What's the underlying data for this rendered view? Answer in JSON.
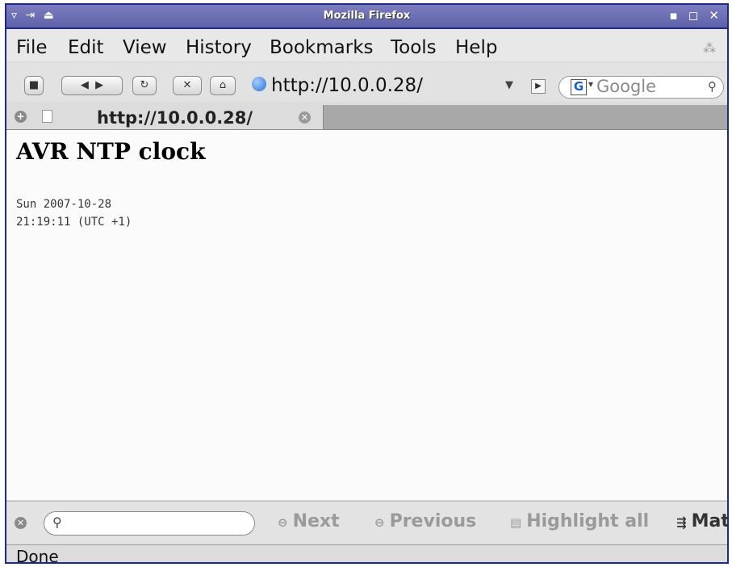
{
  "window": {
    "title": "Mozilla Firefox",
    "left_controls": "▿ ⇥ ⏏",
    "right_controls": "▪ ◻ ✕"
  },
  "menubar": {
    "items": [
      "File",
      "Edit",
      "View",
      "History",
      "Bookmarks",
      "Tools",
      "Help"
    ]
  },
  "navbar": {
    "url": "http://10.0.0.28/",
    "search_placeholder": "Google",
    "search_engine_letter": "G"
  },
  "tab": {
    "label": "http://10.0.0.28/"
  },
  "page": {
    "heading": "AVR NTP clock",
    "date_line": "Sun 2007-10-28",
    "time_line": "21:19:11 (UTC +1)"
  },
  "findbar": {
    "next_label": "Next",
    "previous_label": "Previous",
    "highlight_label": "Highlight all",
    "match_case_label": "Mat"
  },
  "statusbar": {
    "status": "Done"
  }
}
